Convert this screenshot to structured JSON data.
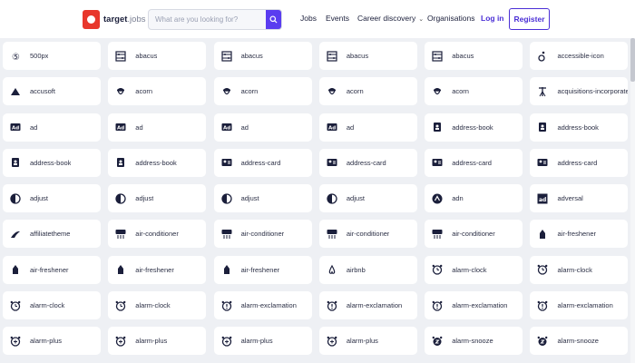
{
  "header": {
    "logo_text": "target",
    "logo_sub": "jobs",
    "search_placeholder": "What are you looking for?",
    "links": {
      "jobs": "Jobs",
      "events": "Events",
      "career_discovery": "Career discovery",
      "organisations": "Organisations",
      "login": "Log in",
      "register": "Register"
    }
  },
  "icons": [
    {
      "label": "500px",
      "icon": "500px-icon"
    },
    {
      "label": "abacus",
      "icon": "abacus-icon"
    },
    {
      "label": "abacus",
      "icon": "abacus-icon"
    },
    {
      "label": "abacus",
      "icon": "abacus-icon"
    },
    {
      "label": "abacus",
      "icon": "abacus-icon"
    },
    {
      "label": "accessible-icon",
      "icon": "accessible-icon"
    },
    {
      "label": "accusoft",
      "icon": "accusoft-icon"
    },
    {
      "label": "acorn",
      "icon": "acorn-icon"
    },
    {
      "label": "acorn",
      "icon": "acorn-icon"
    },
    {
      "label": "acorn",
      "icon": "acorn-icon"
    },
    {
      "label": "acorn",
      "icon": "acorn-icon"
    },
    {
      "label": "acquisitions-incorporated",
      "icon": "acquisitions-incorporated-icon"
    },
    {
      "label": "ad",
      "icon": "ad-icon"
    },
    {
      "label": "ad",
      "icon": "ad-icon"
    },
    {
      "label": "ad",
      "icon": "ad-icon"
    },
    {
      "label": "ad",
      "icon": "ad-icon"
    },
    {
      "label": "address-book",
      "icon": "address-book-icon"
    },
    {
      "label": "address-book",
      "icon": "address-book-icon"
    },
    {
      "label": "address-book",
      "icon": "address-book-icon"
    },
    {
      "label": "address-book",
      "icon": "address-book-icon"
    },
    {
      "label": "address-card",
      "icon": "address-card-icon"
    },
    {
      "label": "address-card",
      "icon": "address-card-icon"
    },
    {
      "label": "address-card",
      "icon": "address-card-icon"
    },
    {
      "label": "address-card",
      "icon": "address-card-icon"
    },
    {
      "label": "adjust",
      "icon": "adjust-icon"
    },
    {
      "label": "adjust",
      "icon": "adjust-icon"
    },
    {
      "label": "adjust",
      "icon": "adjust-icon"
    },
    {
      "label": "adjust",
      "icon": "adjust-icon"
    },
    {
      "label": "adn",
      "icon": "adn-icon"
    },
    {
      "label": "adversal",
      "icon": "adversal-icon"
    },
    {
      "label": "affiliatetheme",
      "icon": "affiliatetheme-icon"
    },
    {
      "label": "air-conditioner",
      "icon": "air-conditioner-icon"
    },
    {
      "label": "air-conditioner",
      "icon": "air-conditioner-icon"
    },
    {
      "label": "air-conditioner",
      "icon": "air-conditioner-icon"
    },
    {
      "label": "air-conditioner",
      "icon": "air-conditioner-icon"
    },
    {
      "label": "air-freshener",
      "icon": "air-freshener-icon"
    },
    {
      "label": "air-freshener",
      "icon": "air-freshener-icon"
    },
    {
      "label": "air-freshener",
      "icon": "air-freshener-icon"
    },
    {
      "label": "air-freshener",
      "icon": "air-freshener-icon"
    },
    {
      "label": "airbnb",
      "icon": "airbnb-icon"
    },
    {
      "label": "alarm-clock",
      "icon": "alarm-clock-icon"
    },
    {
      "label": "alarm-clock",
      "icon": "alarm-clock-icon"
    },
    {
      "label": "alarm-clock",
      "icon": "alarm-clock-icon"
    },
    {
      "label": "alarm-clock",
      "icon": "alarm-clock-icon"
    },
    {
      "label": "alarm-exclamation",
      "icon": "alarm-exclamation-icon"
    },
    {
      "label": "alarm-exclamation",
      "icon": "alarm-exclamation-icon"
    },
    {
      "label": "alarm-exclamation",
      "icon": "alarm-exclamation-icon"
    },
    {
      "label": "alarm-exclamation",
      "icon": "alarm-exclamation-icon"
    },
    {
      "label": "alarm-plus",
      "icon": "alarm-plus-icon"
    },
    {
      "label": "alarm-plus",
      "icon": "alarm-plus-icon"
    },
    {
      "label": "alarm-plus",
      "icon": "alarm-plus-icon"
    },
    {
      "label": "alarm-plus",
      "icon": "alarm-plus-icon"
    },
    {
      "label": "alarm-snooze",
      "icon": "alarm-snooze-icon"
    },
    {
      "label": "alarm-snooze",
      "icon": "alarm-snooze-icon"
    }
  ],
  "colors": {
    "brand_red": "#e8372c",
    "accent_purple": "#4b2fd6",
    "search_button": "#5a3cf0",
    "page_bg": "#eef0f4"
  }
}
